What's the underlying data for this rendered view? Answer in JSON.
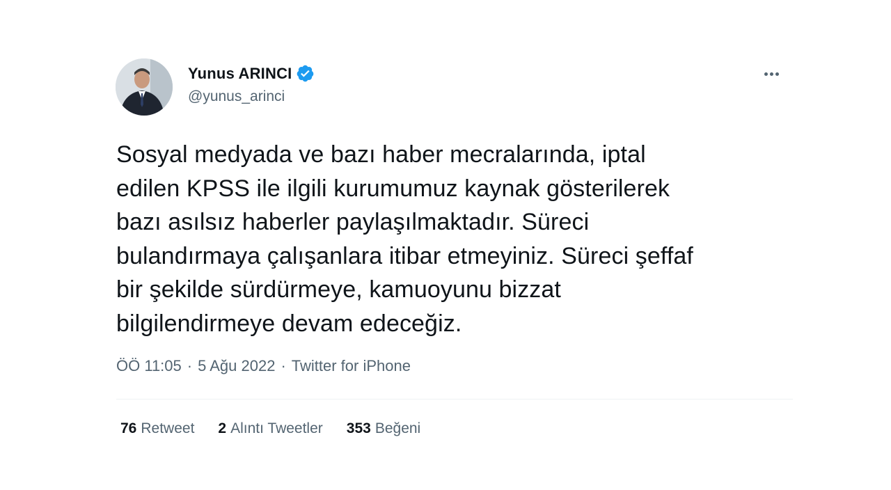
{
  "author": {
    "display_name": "Yunus ARINCI",
    "handle": "@yunus_arinci",
    "verified": true,
    "avatar_icon": "profile-photo"
  },
  "tweet": {
    "lines": [
      "Sosyal medyada ve bazı haber mecralarında, iptal",
      "edilen KPSS ile ilgili kurumumuz kaynak gösterilerek",
      "bazı asılsız haberler paylaşılmaktadır. Süreci",
      "bulandırmaya çalışanlara itibar etmeyiniz. Süreci şeffaf",
      "bir şekilde sürdürmeye, kamuoyunu bizzat",
      "bilgilendirmeye devam edeceğiz."
    ]
  },
  "meta": {
    "time": "ÖÖ 11:05",
    "separator": "·",
    "date": "5 Ağu 2022",
    "source": "Twitter for iPhone"
  },
  "stats": {
    "retweets": {
      "count": "76",
      "label": "Retweet"
    },
    "quotes": {
      "count": "2",
      "label": "Alıntı Tweetler"
    },
    "likes": {
      "count": "353",
      "label": "Beğeni"
    }
  },
  "colors": {
    "verified_badge": "#1d9bf0",
    "secondary_text": "#536471",
    "primary_text": "#0f1419"
  }
}
